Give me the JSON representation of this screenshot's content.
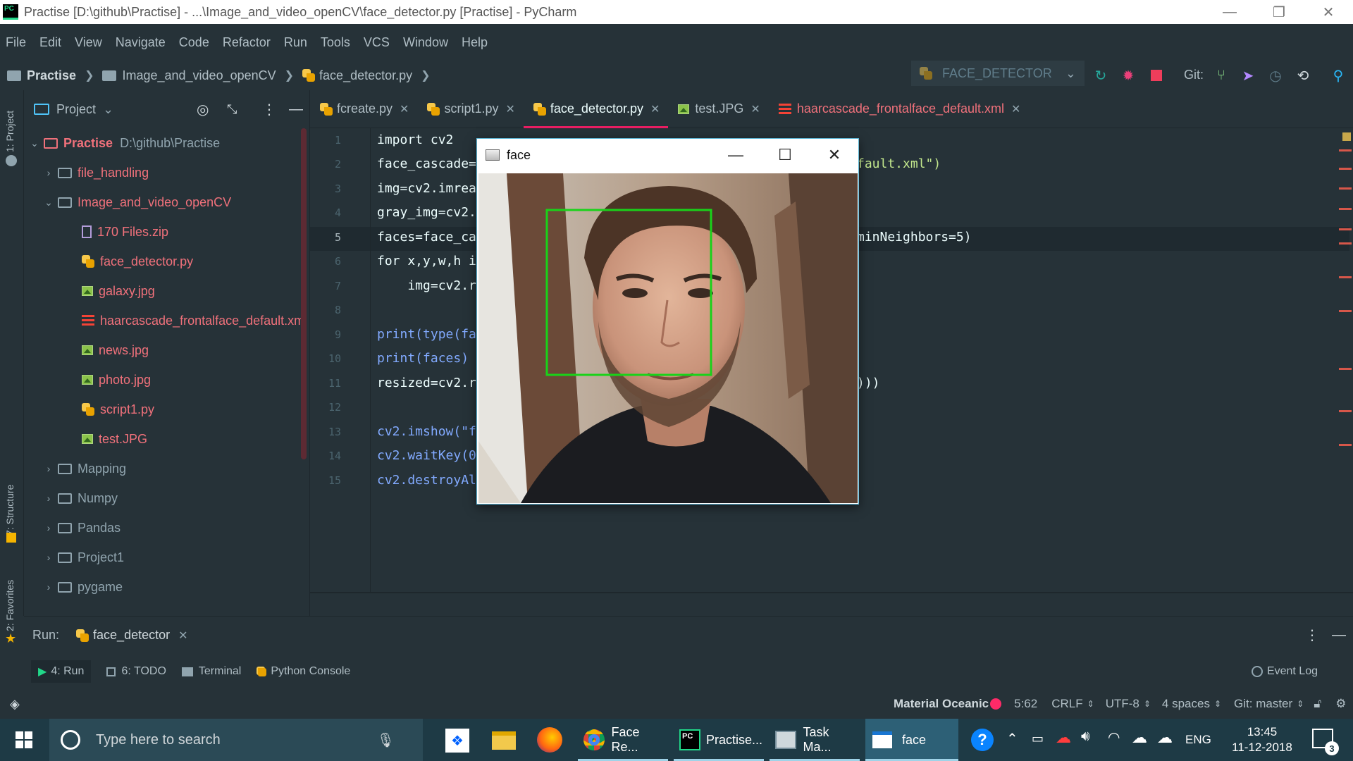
{
  "window": {
    "title": "Practise [D:\\github\\Practise] - ...\\Image_and_video_openCV\\face_detector.py [Practise] - PyCharm",
    "app_logo": "PC"
  },
  "menu": [
    "File",
    "Edit",
    "View",
    "Navigate",
    "Code",
    "Refactor",
    "Run",
    "Tools",
    "VCS",
    "Window",
    "Help"
  ],
  "breadcrumb": {
    "project": "Practise",
    "folder": "Image_and_video_openCV",
    "file": "face_detector.py"
  },
  "toolbar": {
    "run_config": "FACE_DETECTOR",
    "git_label": "Git:"
  },
  "sidebar_strip": {
    "project": "1: Project",
    "structure": "7: Structure",
    "favorites": "2: Favorites"
  },
  "project_panel": {
    "header": "Project",
    "root_name": "Practise",
    "root_path": "D:\\github\\Practise",
    "items": [
      {
        "label": "file_handling",
        "kind": "folder",
        "color": "red"
      },
      {
        "label": "Image_and_video_openCV",
        "kind": "folder",
        "color": "red",
        "expanded": true
      },
      {
        "label": "170 Files.zip",
        "kind": "zip",
        "color": "red"
      },
      {
        "label": "face_detector.py",
        "kind": "py",
        "color": "red"
      },
      {
        "label": "galaxy.jpg",
        "kind": "img",
        "color": "red"
      },
      {
        "label": "haarcascade_frontalface_default.xml",
        "kind": "xml",
        "color": "red"
      },
      {
        "label": "news.jpg",
        "kind": "img",
        "color": "red"
      },
      {
        "label": "photo.jpg",
        "kind": "img",
        "color": "red"
      },
      {
        "label": "script1.py",
        "kind": "py",
        "color": "red"
      },
      {
        "label": "test.JPG",
        "kind": "img",
        "color": "red"
      },
      {
        "label": "Mapping",
        "kind": "folder",
        "color": "gray"
      },
      {
        "label": "Numpy",
        "kind": "folder",
        "color": "gray"
      },
      {
        "label": "Pandas",
        "kind": "folder",
        "color": "gray"
      },
      {
        "label": "Project1",
        "kind": "folder",
        "color": "gray"
      },
      {
        "label": "pygame",
        "kind": "folder",
        "color": "gray"
      }
    ]
  },
  "tabs": [
    {
      "label": "fcreate.py",
      "icon": "python-icon"
    },
    {
      "label": "script1.py",
      "icon": "python-icon"
    },
    {
      "label": "face_detector.py",
      "icon": "python-icon",
      "active": true
    },
    {
      "label": "test.JPG",
      "icon": "image-icon"
    },
    {
      "label": "haarcascade_frontalface_default.xml",
      "icon": "xml-icon"
    }
  ],
  "editor": {
    "current_line": 5,
    "lines": [
      {
        "n": "1",
        "left": "import cv2",
        "right": ""
      },
      {
        "n": "2",
        "left": "face_cascade=",
        "right": "fault.xml\")"
      },
      {
        "n": "3",
        "left": "img=cv2.imrea",
        "right": ""
      },
      {
        "n": "4",
        "left": "gray_img=cv2.",
        "right": ""
      },
      {
        "n": "5",
        "left": "faces=face_ca",
        "right": "minNeighbors=5)"
      },
      {
        "n": "6",
        "left": "for x,y,w,h i",
        "right": ""
      },
      {
        "n": "7",
        "left": "    img=cv2.r",
        "right": ""
      },
      {
        "n": "8",
        "left": "",
        "right": ""
      },
      {
        "n": "9",
        "left": "print(type(fa",
        "right": ""
      },
      {
        "n": "10",
        "left": "print(faces)",
        "right": ""
      },
      {
        "n": "11",
        "left": "resized=cv2.r",
        "right": ")))"
      },
      {
        "n": "12",
        "left": "",
        "right": ""
      },
      {
        "n": "13",
        "left": "cv2.imshow(\"f",
        "right": ""
      },
      {
        "n": "14",
        "left": "cv2.waitKey(0",
        "right": ""
      },
      {
        "n": "15",
        "left": "cv2.destroyAl",
        "right": ""
      }
    ]
  },
  "face_window": {
    "title": "face"
  },
  "run_panel": {
    "label": "Run:",
    "config": "face_detector"
  },
  "tool_windows": [
    "4: Run",
    "6: TODO",
    "Terminal",
    "Python Console"
  ],
  "event_log": "Event Log",
  "status": {
    "theme": "Material Oceanic",
    "position": "5:62",
    "line_sep": "CRLF",
    "encoding": "UTF-8",
    "indent": "4 spaces",
    "git": "Git: master"
  },
  "taskbar": {
    "search_placeholder": "Type here to search",
    "apps": [
      "Face Re...",
      "Practise...",
      "Task Ma...",
      "face"
    ],
    "lang": "ENG",
    "time": "13:45",
    "date": "11-12-2018",
    "notifications": "3"
  },
  "colors": {
    "bg": "#263238",
    "accent": "#e91e63",
    "tree_red": "#f0717b",
    "face_box": "#19d219"
  }
}
